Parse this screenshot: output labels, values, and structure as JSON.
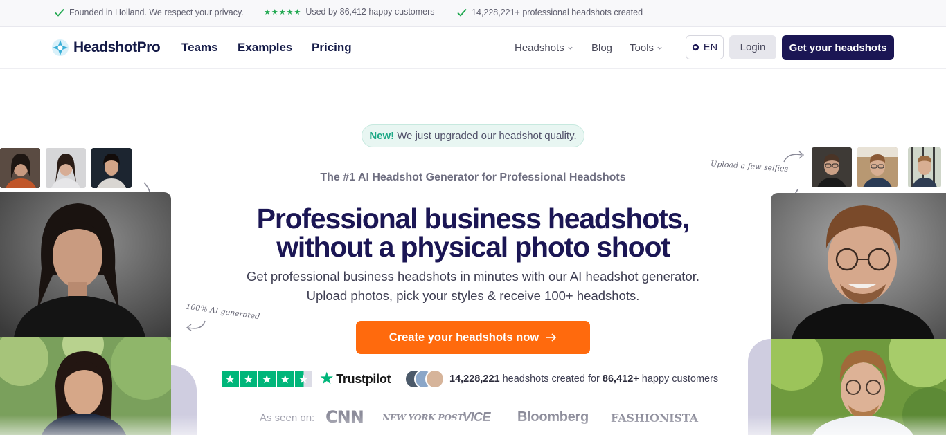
{
  "topbar": {
    "items": [
      {
        "text": "Founded in Holland. We respect your privacy.",
        "icon": "check-icon"
      },
      {
        "text": "Used by 86,412 happy customers",
        "stars": "★★★★★",
        "icon": "star-icon"
      },
      {
        "text": "14,228,221+ professional headshots created",
        "icon": "check-icon"
      }
    ]
  },
  "nav": {
    "brand": "HeadshotPro",
    "main_links": [
      "Teams",
      "Examples",
      "Pricing"
    ],
    "secondary": {
      "headshots": "Headshots",
      "blog": "Blog",
      "tools": "Tools"
    },
    "lang": "EN",
    "login": "Login",
    "cta": "Get your headshots"
  },
  "hero": {
    "pill_new": "New!",
    "pill_text": "We just upgraded our",
    "pill_link": "headshot quality.",
    "kicker": "The #1 AI Headshot Generator for Professional Headshots",
    "headline_line1": "Professional business headshots,",
    "headline_line2": "without a physical photo shoot",
    "sub": "Get professional business headshots in minutes with our AI headshot generator. Upload photos, pick your styles & receive 100+ headshots.",
    "cta": "Create your headshots now",
    "note_left": "100% AI generated",
    "note_right": "Upload a few selfies"
  },
  "social_proof": {
    "trustpilot": "Trustpilot",
    "stat_count": "14,228,221",
    "stat_mid": "headshots created for",
    "stat_customers": "86,412+",
    "stat_end": "happy customers"
  },
  "press": {
    "label": "As seen on:",
    "logos": [
      "CNN",
      "NEW YORK POST",
      "VICE",
      "Bloomberg",
      "FASHIONISTA"
    ]
  },
  "colors": {
    "brand_navy": "#1b1654",
    "cta_orange": "#ff6a0d",
    "trustpilot_green": "#00b67a",
    "check_green": "#1fa84f"
  }
}
